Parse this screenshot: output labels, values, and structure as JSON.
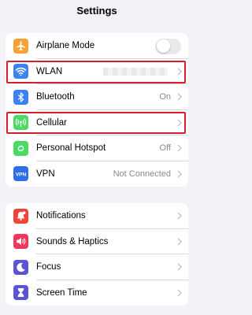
{
  "header": {
    "title": "Settings"
  },
  "group1": [
    {
      "label": "Airplane Mode",
      "icon": "airplane-icon",
      "color": "#f7a033",
      "control": "toggle",
      "toggle_on": false
    },
    {
      "label": "WLAN",
      "icon": "wifi-icon",
      "color": "#3a82f7",
      "control": "blurred-value"
    },
    {
      "label": "Bluetooth",
      "icon": "bluetooth-icon",
      "color": "#3a82f7",
      "value": "On"
    },
    {
      "label": "Cellular",
      "icon": "cellular-icon",
      "color": "#4cd964"
    },
    {
      "label": "Personal Hotspot",
      "icon": "hotspot-icon",
      "color": "#4cd964",
      "value": "Off"
    },
    {
      "label": "VPN",
      "icon": "vpn-icon",
      "color": "#2f6ee8",
      "value": "Not Connected",
      "icon_text": "VPN"
    }
  ],
  "group2": [
    {
      "label": "Notifications",
      "icon": "bell-icon",
      "color": "#f0443a"
    },
    {
      "label": "Sounds & Haptics",
      "icon": "speaker-icon",
      "color": "#f0395a"
    },
    {
      "label": "Focus",
      "icon": "moon-icon",
      "color": "#5b55d6"
    },
    {
      "label": "Screen Time",
      "icon": "hourglass-icon",
      "color": "#5b55d6"
    }
  ],
  "highlights": [
    "WLAN",
    "Cellular"
  ],
  "colors": {
    "highlight": "#d81e2a",
    "background": "#f2f2f7",
    "secondary_text": "#8a8a8e"
  }
}
